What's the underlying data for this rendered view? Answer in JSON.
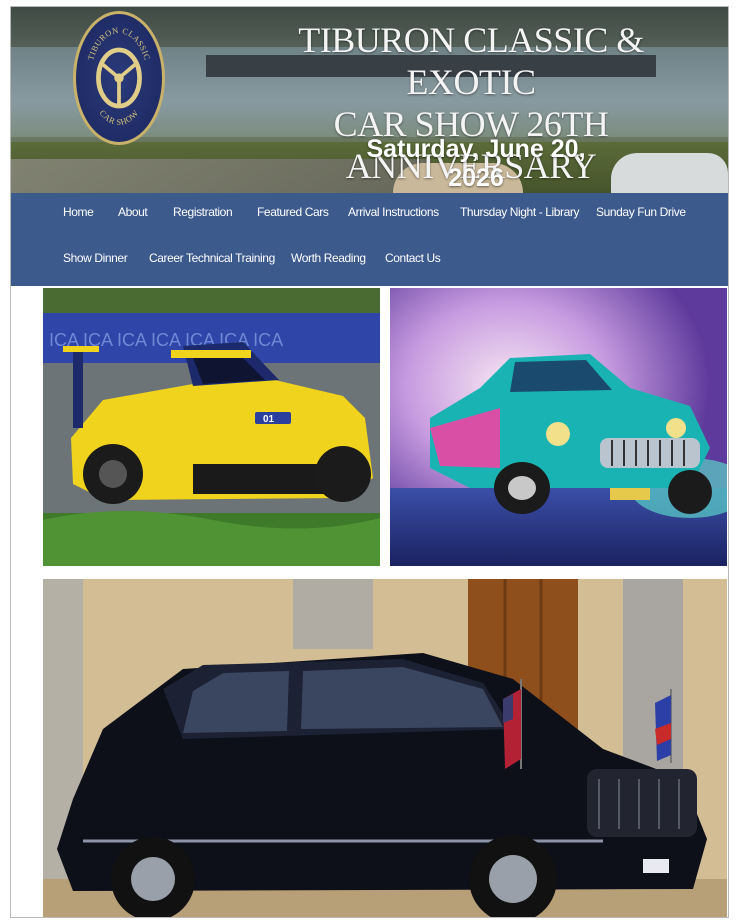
{
  "header": {
    "logo_text": "TIBURON CLASSIC CAR SHOW",
    "title_line1": "TIBURON CLASSIC & EXOTIC",
    "title_line2": "CAR SHOW 26TH ANNIVERSARY",
    "date": "Saturday, June 20, 2026"
  },
  "nav": {
    "row1": [
      "Home",
      "About",
      "Registration",
      "Featured Cars",
      "Arrival Instructions",
      "Thursday Night - Library",
      "Sunday Fun Drive"
    ],
    "row2": [
      "Show Dinner",
      "Career Technical Training",
      "Worth Reading",
      "Contact Us"
    ]
  },
  "gallery": {
    "images": [
      {
        "subject": "yellow race car"
      },
      {
        "subject": "teal classic car"
      },
      {
        "subject": "black presidential limousine"
      }
    ]
  },
  "colors": {
    "nav_background": "#3d5a8c",
    "nav_text": "#ffffff"
  }
}
